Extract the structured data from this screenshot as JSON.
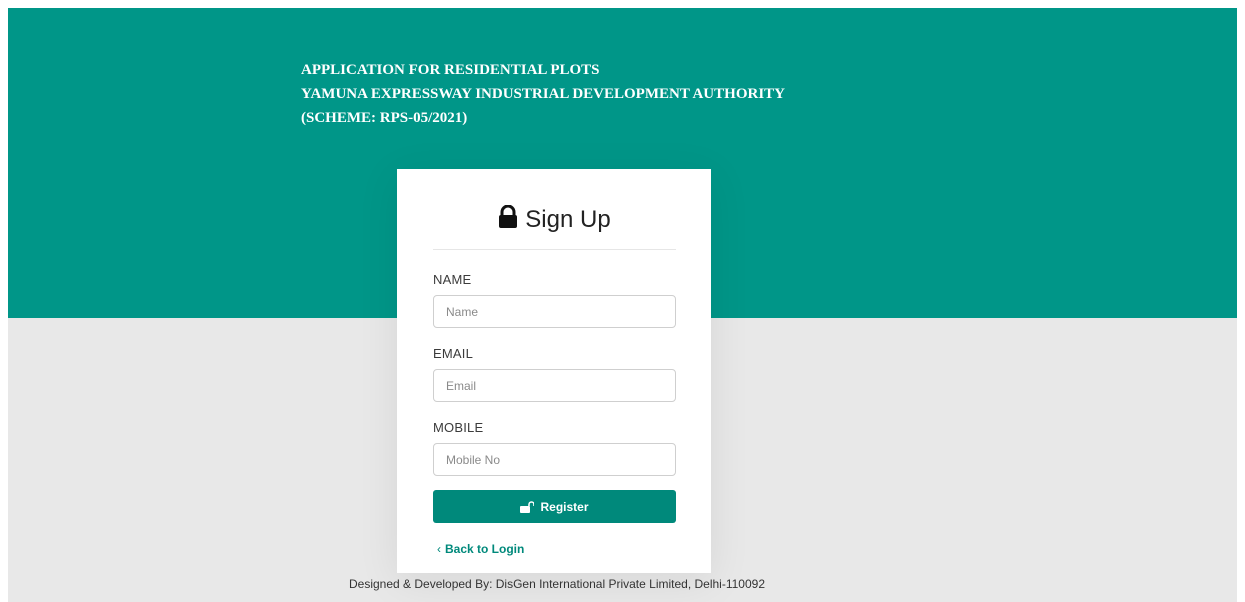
{
  "header": {
    "line1": "APPLICATION FOR RESIDENTIAL PLOTS",
    "line2": "YAMUNA EXPRESSWAY INDUSTRIAL DEVELOPMENT AUTHORITY",
    "line3": "(SCHEME: RPS-05/2021)"
  },
  "card": {
    "title": "Sign Up",
    "title_icon": "lock-icon",
    "fields": {
      "name": {
        "label": "NAME",
        "placeholder": "Name",
        "value": ""
      },
      "email": {
        "label": "EMAIL",
        "placeholder": "Email",
        "value": ""
      },
      "mobile": {
        "label": "MOBILE",
        "placeholder": "Mobile No",
        "value": ""
      }
    },
    "register_label": "Register",
    "register_icon": "unlock-icon",
    "back_label": "Back to Login",
    "back_icon": "chevron-left-icon"
  },
  "footer": {
    "text": "Designed & Developed By: DisGen International Private Limited, Delhi-110092"
  },
  "colors": {
    "brand": "#009688",
    "button": "#00897b",
    "background": "#e8e8e8"
  }
}
